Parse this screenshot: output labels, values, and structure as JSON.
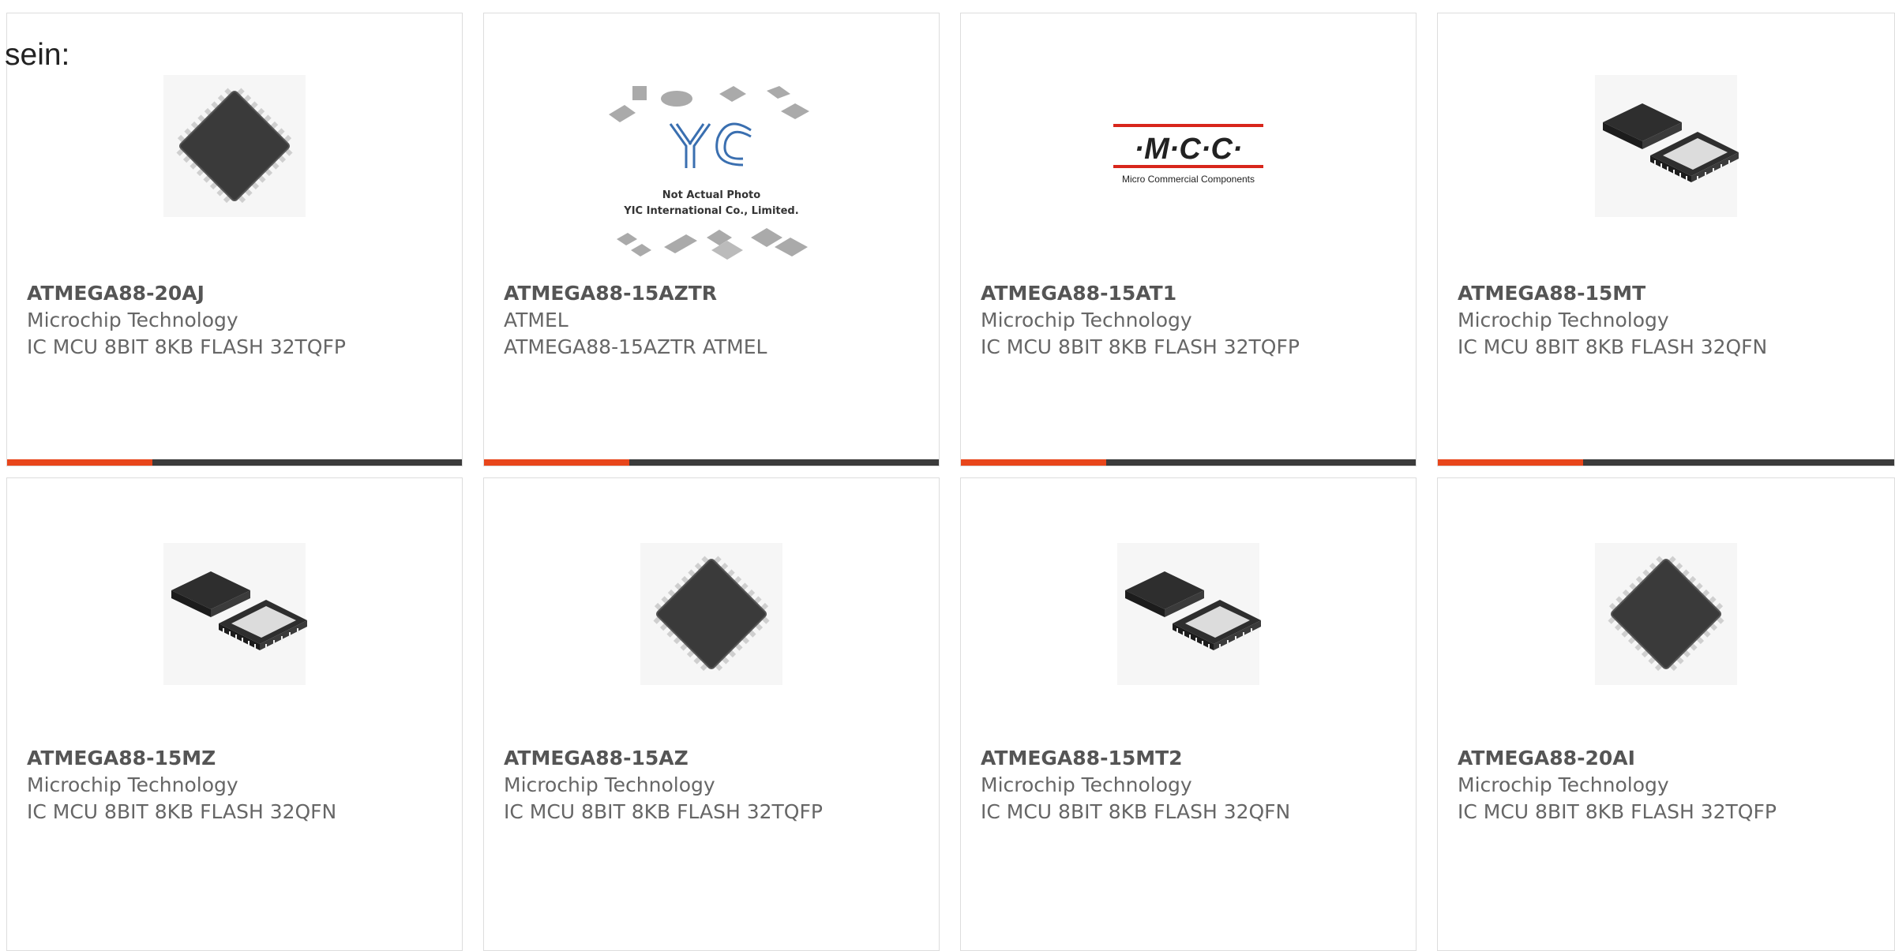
{
  "intro_text": "sein:",
  "colors": {
    "accent": "#e8461b",
    "bar": "#3b3b3b",
    "border": "#dddddd",
    "text": "#666666"
  },
  "products": [
    {
      "part_number": "ATMEGA88-20AJ",
      "manufacturer": "Microchip Technology",
      "description": "IC MCU 8BIT 8KB FLASH 32TQFP",
      "image": "tqfp-chip-icon",
      "has_bar": true
    },
    {
      "part_number": "ATMEGA88-15AZTR",
      "manufacturer": "ATMEL",
      "description": "ATMEGA88-15AZTR ATMEL",
      "image": "yic-placeholder-logo",
      "image_text": [
        "Not Actual Photo",
        "YIC International Co., Limited."
      ],
      "has_bar": true
    },
    {
      "part_number": "ATMEGA88-15AT1",
      "manufacturer": "Microchip Technology",
      "description": "IC MCU 8BIT 8KB FLASH 32TQFP",
      "image": "mcc-logo",
      "image_text": [
        "·M·C·C·",
        "Micro Commercial Components"
      ],
      "has_bar": true
    },
    {
      "part_number": "ATMEGA88-15MT",
      "manufacturer": "Microchip Technology",
      "description": "IC MCU 8BIT 8KB FLASH 32QFN",
      "image": "qfn-chip-icon",
      "has_bar": true
    },
    {
      "part_number": "ATMEGA88-15MZ",
      "manufacturer": "Microchip Technology",
      "description": "IC MCU 8BIT 8KB FLASH 32QFN",
      "image": "qfn-chip-icon",
      "has_bar": false
    },
    {
      "part_number": "ATMEGA88-15AZ",
      "manufacturer": "Microchip Technology",
      "description": "IC MCU 8BIT 8KB FLASH 32TQFP",
      "image": "tqfp-chip-icon",
      "has_bar": false
    },
    {
      "part_number": "ATMEGA88-15MT2",
      "manufacturer": "Microchip Technology",
      "description": "IC MCU 8BIT 8KB FLASH 32QFN",
      "image": "qfn-chip-icon",
      "has_bar": false
    },
    {
      "part_number": "ATMEGA88-20AI",
      "manufacturer": "Microchip Technology",
      "description": "IC MCU 8BIT 8KB FLASH 32TQFP",
      "image": "tqfp-chip-icon",
      "has_bar": false
    }
  ]
}
